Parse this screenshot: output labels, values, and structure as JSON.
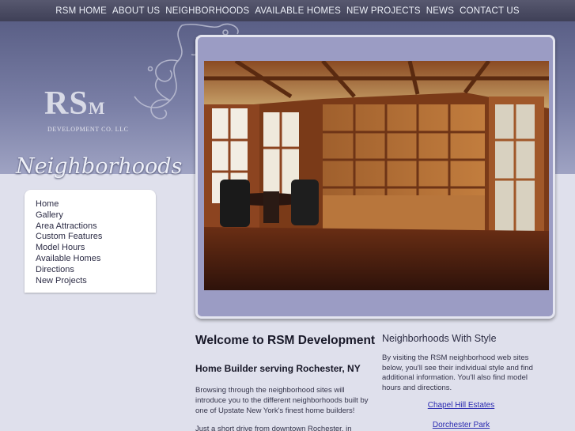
{
  "nav": {
    "items": [
      "RSM HOME",
      "ABOUT US",
      "NEIGHBORHOODS",
      "AVAILABLE HOMES",
      "NEW PROJECTS",
      "NEWS",
      "CONTACT US"
    ]
  },
  "header": {
    "logo_rs": "RS",
    "logo_m": "M",
    "logo_sub": "DEVELOPMENT CO. LLC",
    "tagline": "Neighborhoods"
  },
  "sidebar": {
    "items": [
      "Home",
      "Gallery",
      "Area Attractions",
      "Custom Features",
      "Model Hours",
      "Available Homes",
      "Directions",
      "New Projects"
    ]
  },
  "main": {
    "heading": "Welcome to RSM Development",
    "subheading": "Home Builder serving Rochester, NY",
    "para1": "Browsing through the neighborhood sites will introduce you to the different neighborhoods built by one of Upstate New York's finest home builders!",
    "para2": "Just a short drive from downtown Rochester, in Penfield,"
  },
  "right": {
    "heading": "Neighborhoods With Style",
    "text": "By visiting the RSM neighborhood web sites below, you'll see their individual style and find additional information.  You'll also find model hours and directions.",
    "links": [
      "Chapel Hill Estates",
      "Dorchester Park"
    ]
  },
  "colors": {
    "nav_bg": "#4a4b63",
    "header_bg": "#6b7096",
    "page_bg": "#dfe0ec",
    "frame_bg": "#9b9cc4",
    "link": "#2a2ab0"
  }
}
